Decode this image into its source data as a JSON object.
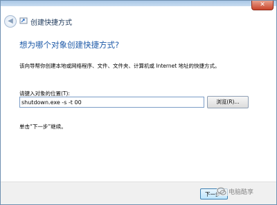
{
  "window": {
    "close_symbol": "✕",
    "back_symbol": "◀",
    "wizard_title": "创建快捷方式"
  },
  "page": {
    "heading": "想为哪个对象创建快捷方式?",
    "description": "该向导帮你创建本地或网络程序、文件、文件夹、计算机或 Internet 地址的快捷方式。",
    "location_label": "请键入对象的位置(T):",
    "location_value": "shutdown.exe -s -t 00",
    "browse_label": "浏览(R)...",
    "hint": "单击“下一步”继续。"
  },
  "footer": {
    "next_label": "下一步",
    "watermark_text": "电脑酷享"
  },
  "colors": {
    "heading": "#1e5aa8",
    "footer_bg": "#f0f0f0"
  }
}
